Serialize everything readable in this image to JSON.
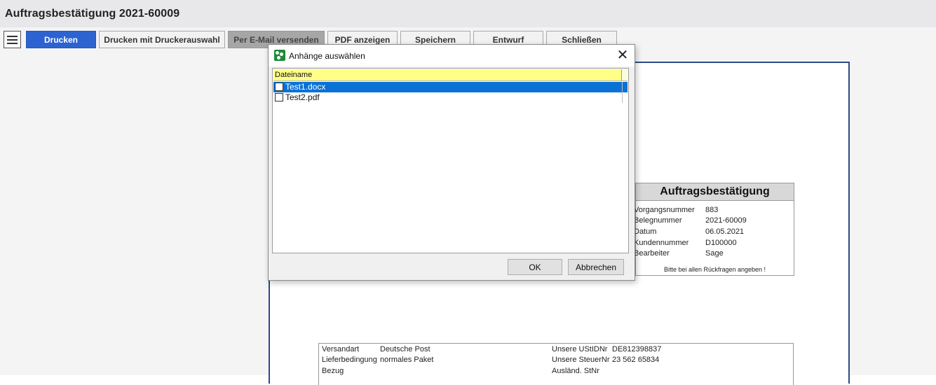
{
  "window": {
    "title": "Auftragsbestätigung 2021-60009"
  },
  "toolbar": {
    "menu_icon": "hamburger-menu-icon",
    "buttons": [
      {
        "label": "Drucken"
      },
      {
        "label": "Drucken mit Druckerauswahl"
      },
      {
        "label": "Per E-Mail versenden"
      },
      {
        "label": "PDF anzeigen"
      },
      {
        "label": "Speichern"
      },
      {
        "label": "Entwurf"
      },
      {
        "label": "Schließen"
      }
    ]
  },
  "colors": {
    "primary": "#2c63d0",
    "selection": "#0a72d6",
    "header_yellow": "#ffff88",
    "doc_border": "#2a4a86"
  },
  "document": {
    "order_box": {
      "heading": "Auftragsbestätigung",
      "fields": [
        {
          "label": "Vorgangsnummer",
          "value": "883"
        },
        {
          "label": "Belegnummer",
          "value": "2021-60009"
        },
        {
          "label": "Datum",
          "value": "06.05.2021"
        },
        {
          "label": "Kundennummer",
          "value": "D100000"
        },
        {
          "label": "Bearbeiter",
          "value": "Sage"
        }
      ],
      "note": "Bitte bei allen Rückfragen angeben !"
    },
    "shipping": {
      "left": [
        {
          "label": "Versandart",
          "value": "Deutsche Post"
        },
        {
          "label": "Lieferbedingung",
          "value": "normales Paket"
        },
        {
          "label": "Bezug",
          "value": ""
        }
      ],
      "right": [
        {
          "label": "Unsere UStIDNr",
          "value": "DE812398837"
        },
        {
          "label": "Unsere SteuerNr",
          "value": "23 562 65834"
        },
        {
          "label": "Ausländ. StNr",
          "value": ""
        }
      ]
    }
  },
  "dialog": {
    "title": "Anhänge auswählen",
    "icon": "app-icon",
    "close_symbol": "✕",
    "column_header": "Dateiname",
    "files": [
      {
        "name": "Test1.docx",
        "checked": false,
        "selected": true
      },
      {
        "name": "Test2.pdf",
        "checked": false,
        "selected": false
      }
    ],
    "ok_label": "OK",
    "cancel_label": "Abbrechen"
  }
}
